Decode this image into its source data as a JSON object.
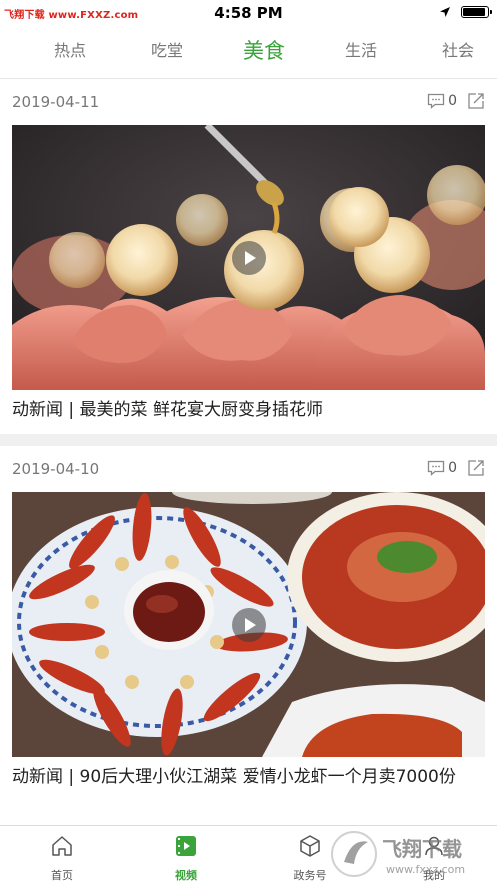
{
  "status_bar": {
    "watermark": "飞翔下载 www.FXXZ.com",
    "time": "4:58 PM",
    "battery_level": 0.92
  },
  "tabs": [
    {
      "label": "热点",
      "active": false
    },
    {
      "label": "吃堂",
      "active": false
    },
    {
      "label": "美食",
      "active": true
    },
    {
      "label": "生活",
      "active": false
    },
    {
      "label": "社会",
      "active": false
    }
  ],
  "feed": [
    {
      "date": "2019-04-11",
      "comment_count": "0",
      "title": "动新闻 | 最美的菜 鲜花宴大厨变身插花师",
      "image": "flower-banquet-dish"
    },
    {
      "date": "2019-04-10",
      "comment_count": "0",
      "title": "动新闻 | 90后大理小伙江湖菜 爱情小龙虾一个月卖7000份",
      "image": "crayfish-dish"
    }
  ],
  "bottom_nav": [
    {
      "label": "首页",
      "icon": "home-icon",
      "active": false
    },
    {
      "label": "视频",
      "icon": "video-icon",
      "active": true
    },
    {
      "label": "政务号",
      "icon": "cube-icon",
      "active": false
    },
    {
      "label": "我的",
      "icon": "user-icon",
      "active": false
    }
  ],
  "watermark_logo": {
    "text": "飞翔下载",
    "url_text": "www.fxxz.com"
  },
  "colors": {
    "accent": "#3aa33c",
    "divider": "#f0f0f0",
    "watermark_red": "#e0241b"
  }
}
